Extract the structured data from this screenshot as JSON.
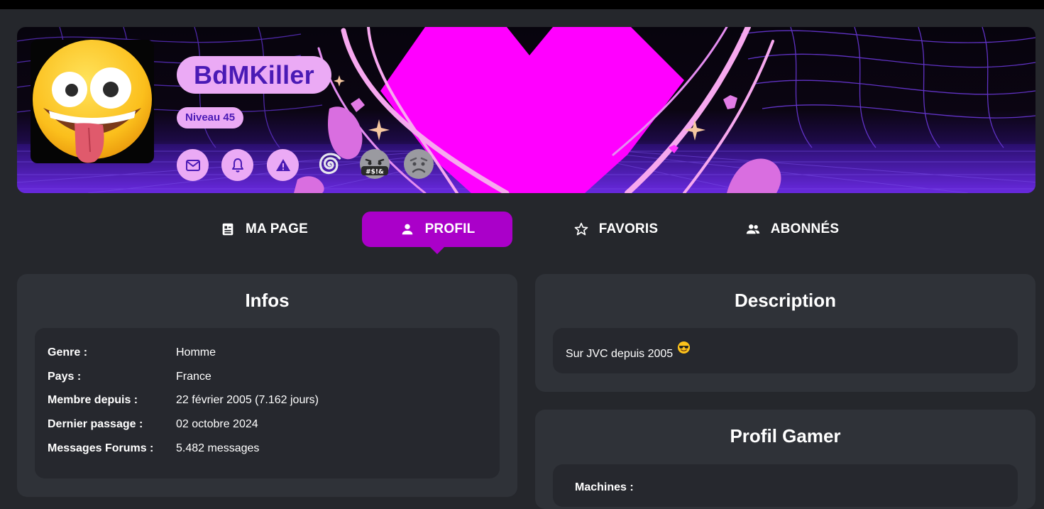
{
  "profile": {
    "username": "BdMKiller",
    "level": "Niveau 45",
    "avatar_icon": "zany-face-emoji",
    "action_icons": [
      "mail-icon",
      "bell-icon",
      "warning-icon",
      "spiral-icon",
      "swearing-face-badge",
      "frowning-face-badge"
    ]
  },
  "tabs": [
    {
      "label": "MA PAGE",
      "icon": "page-icon",
      "active": false
    },
    {
      "label": "PROFIL",
      "icon": "person-icon",
      "active": true
    },
    {
      "label": "FAVORIS",
      "icon": "star-outline-icon",
      "active": false
    },
    {
      "label": "ABONNÉS",
      "icon": "people-icon",
      "active": false
    }
  ],
  "infos": {
    "title": "Infos",
    "rows": [
      {
        "label": "Genre :",
        "value": "Homme"
      },
      {
        "label": "Pays :",
        "value": "France"
      },
      {
        "label": "Membre depuis :",
        "value": "22 février 2005 (7.162 jours)"
      },
      {
        "label": "Dernier passage :",
        "value": "02 octobre 2024"
      },
      {
        "label": "Messages Forums :",
        "value": "5.482 messages"
      }
    ]
  },
  "description": {
    "title": "Description",
    "text": "Sur JVC depuis 2005",
    "emoji": "sunglasses-smiley-icon"
  },
  "gamer": {
    "title": "Profil Gamer",
    "machines_label": "Machines :"
  },
  "colors": {
    "background": "#25272c",
    "card": "#2f3238",
    "card_inner": "#26282e",
    "accent_tab": "#aa00c9",
    "badge_pink": "#ebaaf5",
    "badge_text": "#4a1ab5",
    "banner_heart": "#ff00ff"
  }
}
